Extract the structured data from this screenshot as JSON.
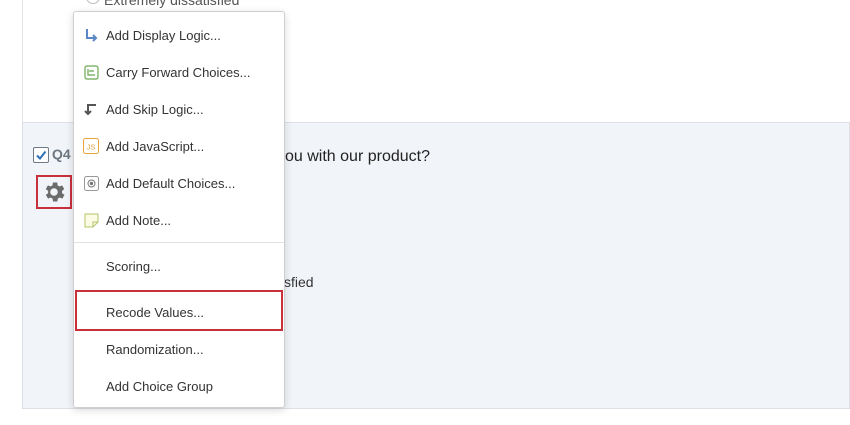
{
  "previous_question": {
    "choice_fragment": "Extremely dissatisfied"
  },
  "question": {
    "number": "Q4",
    "text_fragment": "ou with our product?",
    "visible_choice_fragment": "sfied",
    "checkbox_checked": true
  },
  "menu": {
    "items": [
      {
        "label": "Add Display Logic...",
        "icon": "display-logic-icon",
        "color": "#5a86c5"
      },
      {
        "label": "Carry Forward Choices...",
        "icon": "carry-forward-icon",
        "color": "#6aa84f"
      },
      {
        "label": "Add Skip Logic...",
        "icon": "skip-logic-icon",
        "color": "#555555"
      },
      {
        "label": "Add JavaScript...",
        "icon": "javascript-icon",
        "color": "#e8a33d"
      },
      {
        "label": "Add Default Choices...",
        "icon": "default-choices-icon",
        "color": "#777777"
      },
      {
        "label": "Add Note...",
        "icon": "note-icon",
        "color": "#b5c46a"
      },
      {
        "label": "Scoring..."
      },
      {
        "label": "Recode Values..."
      },
      {
        "label": "Randomization..."
      },
      {
        "label": "Add Choice Group"
      }
    ],
    "highlighted_item": "Recode Values..."
  },
  "colors": {
    "highlight_border": "#c8303a",
    "question_bg": "#f1f4f8"
  }
}
